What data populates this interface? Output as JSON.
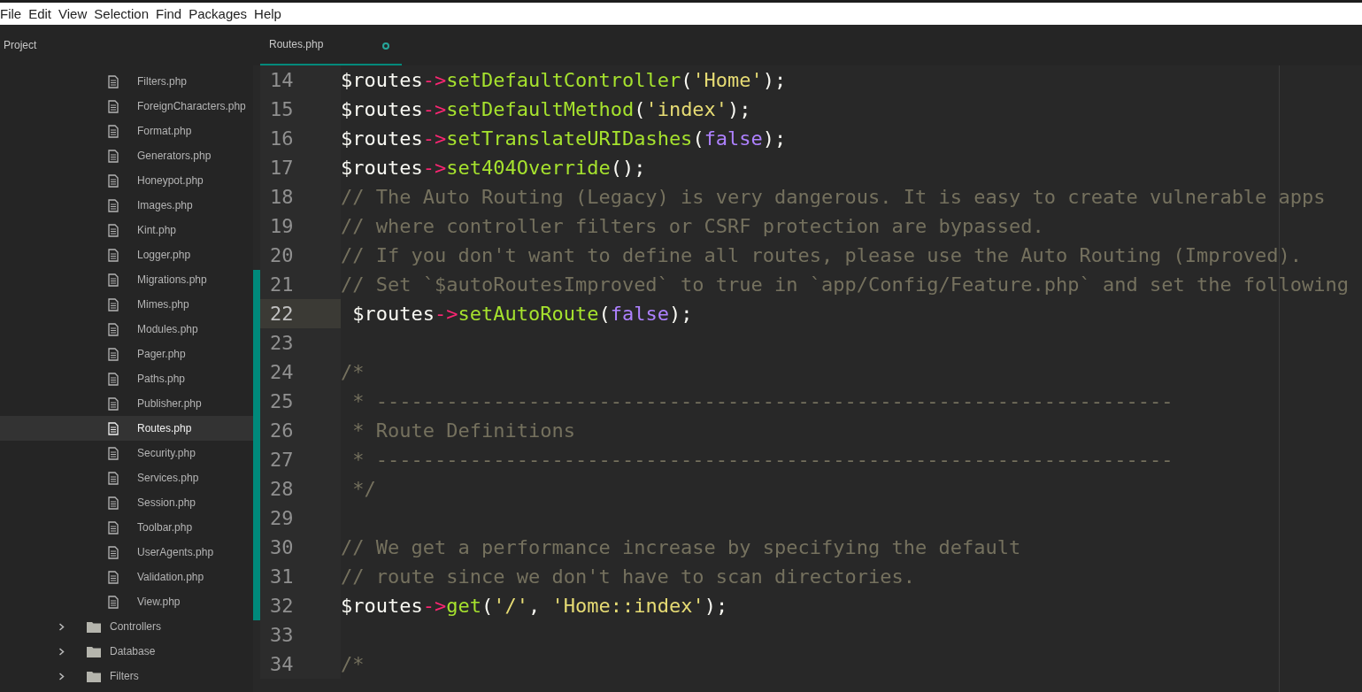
{
  "menu": [
    "File",
    "Edit",
    "View",
    "Selection",
    "Find",
    "Packages",
    "Help"
  ],
  "sidebar": {
    "title": "Project",
    "open_folder_files": [
      {
        "label": "Filters.php",
        "selected": false
      },
      {
        "label": "ForeignCharacters.php",
        "selected": false
      },
      {
        "label": "Format.php",
        "selected": false
      },
      {
        "label": "Generators.php",
        "selected": false
      },
      {
        "label": "Honeypot.php",
        "selected": false
      },
      {
        "label": "Images.php",
        "selected": false
      },
      {
        "label": "Kint.php",
        "selected": false
      },
      {
        "label": "Logger.php",
        "selected": false
      },
      {
        "label": "Migrations.php",
        "selected": false
      },
      {
        "label": "Mimes.php",
        "selected": false
      },
      {
        "label": "Modules.php",
        "selected": false
      },
      {
        "label": "Pager.php",
        "selected": false
      },
      {
        "label": "Paths.php",
        "selected": false
      },
      {
        "label": "Publisher.php",
        "selected": false
      },
      {
        "label": "Routes.php",
        "selected": true
      },
      {
        "label": "Security.php",
        "selected": false
      },
      {
        "label": "Services.php",
        "selected": false
      },
      {
        "label": "Session.php",
        "selected": false
      },
      {
        "label": "Toolbar.php",
        "selected": false
      },
      {
        "label": "UserAgents.php",
        "selected": false
      },
      {
        "label": "Validation.php",
        "selected": false
      },
      {
        "label": "View.php",
        "selected": false
      }
    ],
    "folders": [
      {
        "label": "Controllers",
        "expanded": false
      },
      {
        "label": "Database",
        "expanded": false
      },
      {
        "label": "Filters",
        "expanded": false
      }
    ]
  },
  "tabs": [
    {
      "label": "Routes.php",
      "selected": true,
      "modified": true
    }
  ],
  "editor": {
    "lines": [
      {
        "number": "14",
        "current": false,
        "changed": false,
        "tokens": [
          {
            "kind": "var",
            "text": "$routes"
          },
          {
            "kind": "op",
            "text": "->"
          },
          {
            "kind": "fn",
            "text": "setDefaultController"
          },
          {
            "kind": "punc",
            "text": "("
          },
          {
            "kind": "str",
            "text": "'Home'"
          },
          {
            "kind": "punc",
            "text": ");"
          }
        ]
      },
      {
        "number": "15",
        "current": false,
        "changed": false,
        "tokens": [
          {
            "kind": "var",
            "text": "$routes"
          },
          {
            "kind": "op",
            "text": "->"
          },
          {
            "kind": "fn",
            "text": "setDefaultMethod"
          },
          {
            "kind": "punc",
            "text": "("
          },
          {
            "kind": "str",
            "text": "'index'"
          },
          {
            "kind": "punc",
            "text": ");"
          }
        ]
      },
      {
        "number": "16",
        "current": false,
        "changed": false,
        "tokens": [
          {
            "kind": "var",
            "text": "$routes"
          },
          {
            "kind": "op",
            "text": "->"
          },
          {
            "kind": "fn",
            "text": "setTranslateURIDashes"
          },
          {
            "kind": "punc",
            "text": "("
          },
          {
            "kind": "kw",
            "text": "false"
          },
          {
            "kind": "punc",
            "text": ");"
          }
        ]
      },
      {
        "number": "17",
        "current": false,
        "changed": false,
        "tokens": [
          {
            "kind": "var",
            "text": "$routes"
          },
          {
            "kind": "op",
            "text": "->"
          },
          {
            "kind": "fn",
            "text": "set404Override"
          },
          {
            "kind": "punc",
            "text": "();"
          }
        ]
      },
      {
        "number": "18",
        "current": false,
        "changed": false,
        "tokens": [
          {
            "kind": "comment",
            "text": "// The Auto Routing (Legacy) is very dangerous. It is easy to create vulnerable apps"
          }
        ]
      },
      {
        "number": "19",
        "current": false,
        "changed": false,
        "tokens": [
          {
            "kind": "comment",
            "text": "// where controller filters or CSRF protection are bypassed."
          }
        ]
      },
      {
        "number": "20",
        "current": false,
        "changed": false,
        "tokens": [
          {
            "kind": "comment",
            "text": "// If you don't want to define all routes, please use the Auto Routing (Improved)."
          }
        ]
      },
      {
        "number": "21",
        "current": false,
        "changed": true,
        "tokens": [
          {
            "kind": "comment",
            "text": "// Set `$autoRoutesImproved` to true in `app/Config/Feature.php` and set the following"
          }
        ]
      },
      {
        "number": "22",
        "current": true,
        "changed": true,
        "tokens": [
          {
            "kind": "var",
            "text": " $routes"
          },
          {
            "kind": "op",
            "text": "->"
          },
          {
            "kind": "fn",
            "text": "setAutoRoute"
          },
          {
            "kind": "punc",
            "text": "("
          },
          {
            "kind": "kw",
            "text": "false"
          },
          {
            "kind": "punc",
            "text": ");"
          }
        ]
      },
      {
        "number": "23",
        "current": false,
        "changed": true
      },
      {
        "number": "24",
        "current": false,
        "changed": true,
        "tokens": [
          {
            "kind": "comment",
            "text": "/*"
          }
        ]
      },
      {
        "number": "25",
        "current": false,
        "changed": true,
        "tokens": [
          {
            "kind": "comment",
            "text": " * --------------------------------------------------------------------"
          }
        ]
      },
      {
        "number": "26",
        "current": false,
        "changed": true,
        "tokens": [
          {
            "kind": "comment",
            "text": " * Route Definitions"
          }
        ]
      },
      {
        "number": "27",
        "current": false,
        "changed": true,
        "tokens": [
          {
            "kind": "comment",
            "text": " * --------------------------------------------------------------------"
          }
        ]
      },
      {
        "number": "28",
        "current": false,
        "changed": true,
        "tokens": [
          {
            "kind": "comment",
            "text": " */"
          }
        ]
      },
      {
        "number": "29",
        "current": false,
        "changed": true
      },
      {
        "number": "30",
        "current": false,
        "changed": true,
        "tokens": [
          {
            "kind": "comment",
            "text": "// We get a performance increase by specifying the default"
          }
        ]
      },
      {
        "number": "31",
        "current": false,
        "changed": true,
        "tokens": [
          {
            "kind": "comment",
            "text": "// route since we don't have to scan directories."
          }
        ]
      },
      {
        "number": "32",
        "current": false,
        "changed": true,
        "tokens": [
          {
            "kind": "var",
            "text": "$routes"
          },
          {
            "kind": "op",
            "text": "->"
          },
          {
            "kind": "fn",
            "text": "get"
          },
          {
            "kind": "punc",
            "text": "("
          },
          {
            "kind": "str",
            "text": "'/'"
          },
          {
            "kind": "punc",
            "text": ", "
          },
          {
            "kind": "str",
            "text": "'Home::index'"
          },
          {
            "kind": "punc",
            "text": ");"
          }
        ]
      },
      {
        "number": "33",
        "current": false,
        "changed": false
      },
      {
        "number": "34",
        "current": false,
        "changed": false,
        "tokens": [
          {
            "kind": "comment",
            "text": "/*"
          }
        ]
      }
    ]
  }
}
